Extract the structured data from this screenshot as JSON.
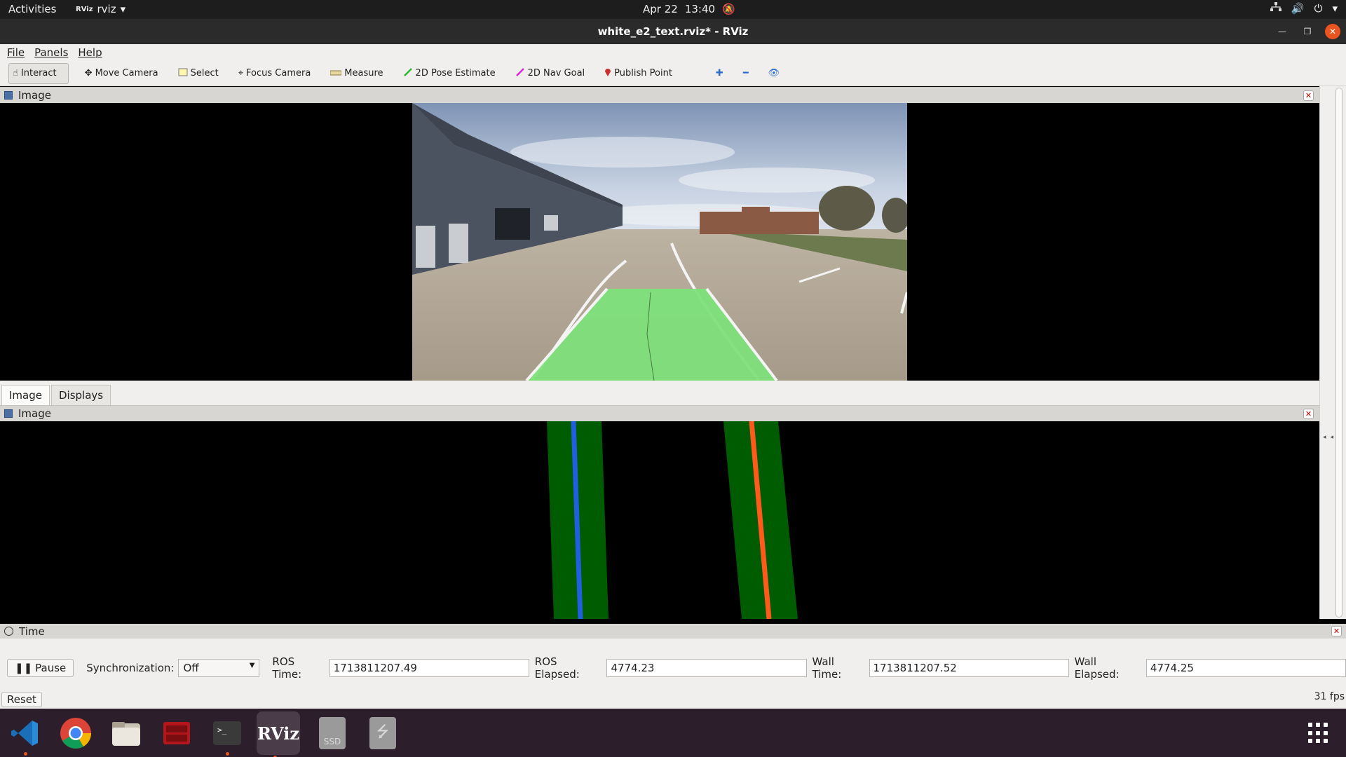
{
  "topbar": {
    "activities": "Activities",
    "app_name": "rviz",
    "date": "Apr 22",
    "time": "13:40"
  },
  "window": {
    "title": "white_e2_text.rviz* - RViz"
  },
  "menubar": [
    "File",
    "Panels",
    "Help"
  ],
  "toolbar": {
    "tools": [
      {
        "label": "Interact",
        "icon": "hand-pointer-icon",
        "active": true
      },
      {
        "label": "Move Camera",
        "icon": "move-arrows-icon"
      },
      {
        "label": "Select",
        "icon": "select-box-icon"
      },
      {
        "label": "Focus Camera",
        "icon": "focus-target-icon"
      },
      {
        "label": "Measure",
        "icon": "ruler-icon"
      },
      {
        "label": "2D Pose Estimate",
        "icon": "green-arrow-icon"
      },
      {
        "label": "2D Nav Goal",
        "icon": "magenta-arrow-icon"
      },
      {
        "label": "Publish Point",
        "icon": "map-pin-icon"
      }
    ]
  },
  "panels": {
    "image_top": {
      "title": "Image"
    },
    "image_bottom": {
      "title": "Image"
    }
  },
  "tabs": [
    "Image",
    "Displays"
  ],
  "time_panel": {
    "title": "Time",
    "pause_label": "Pause",
    "sync_label": "Synchronization:",
    "sync_value": "Off",
    "ros_time_label": "ROS Time:",
    "ros_time": "1713811207.49",
    "ros_elapsed_label": "ROS Elapsed:",
    "ros_elapsed": "4774.23",
    "wall_time_label": "Wall Time:",
    "wall_time": "1713811207.52",
    "wall_elapsed_label": "Wall Elapsed:",
    "wall_elapsed": "4774.25",
    "reset_label": "Reset",
    "fps": "31 fps"
  },
  "dock": {
    "items": [
      {
        "name": "vscode-icon",
        "running": true
      },
      {
        "name": "chrome-icon",
        "running": false
      },
      {
        "name": "files-icon",
        "running": false
      },
      {
        "name": "red-app-icon",
        "running": false
      },
      {
        "name": "terminal-icon",
        "running": true
      },
      {
        "name": "rviz-icon",
        "running": true
      },
      {
        "name": "ssd-drive-icon",
        "running": false
      },
      {
        "name": "usb-drive-icon",
        "running": false
      }
    ],
    "rviz_text": "RViz",
    "ssd_text": "SSD"
  },
  "colors": {
    "accent": "#e95420",
    "lane_fill": "#7ee07a",
    "left_line": "#1f5fe0",
    "right_line": "#ff5a1a",
    "mask_green": "#005c00"
  }
}
